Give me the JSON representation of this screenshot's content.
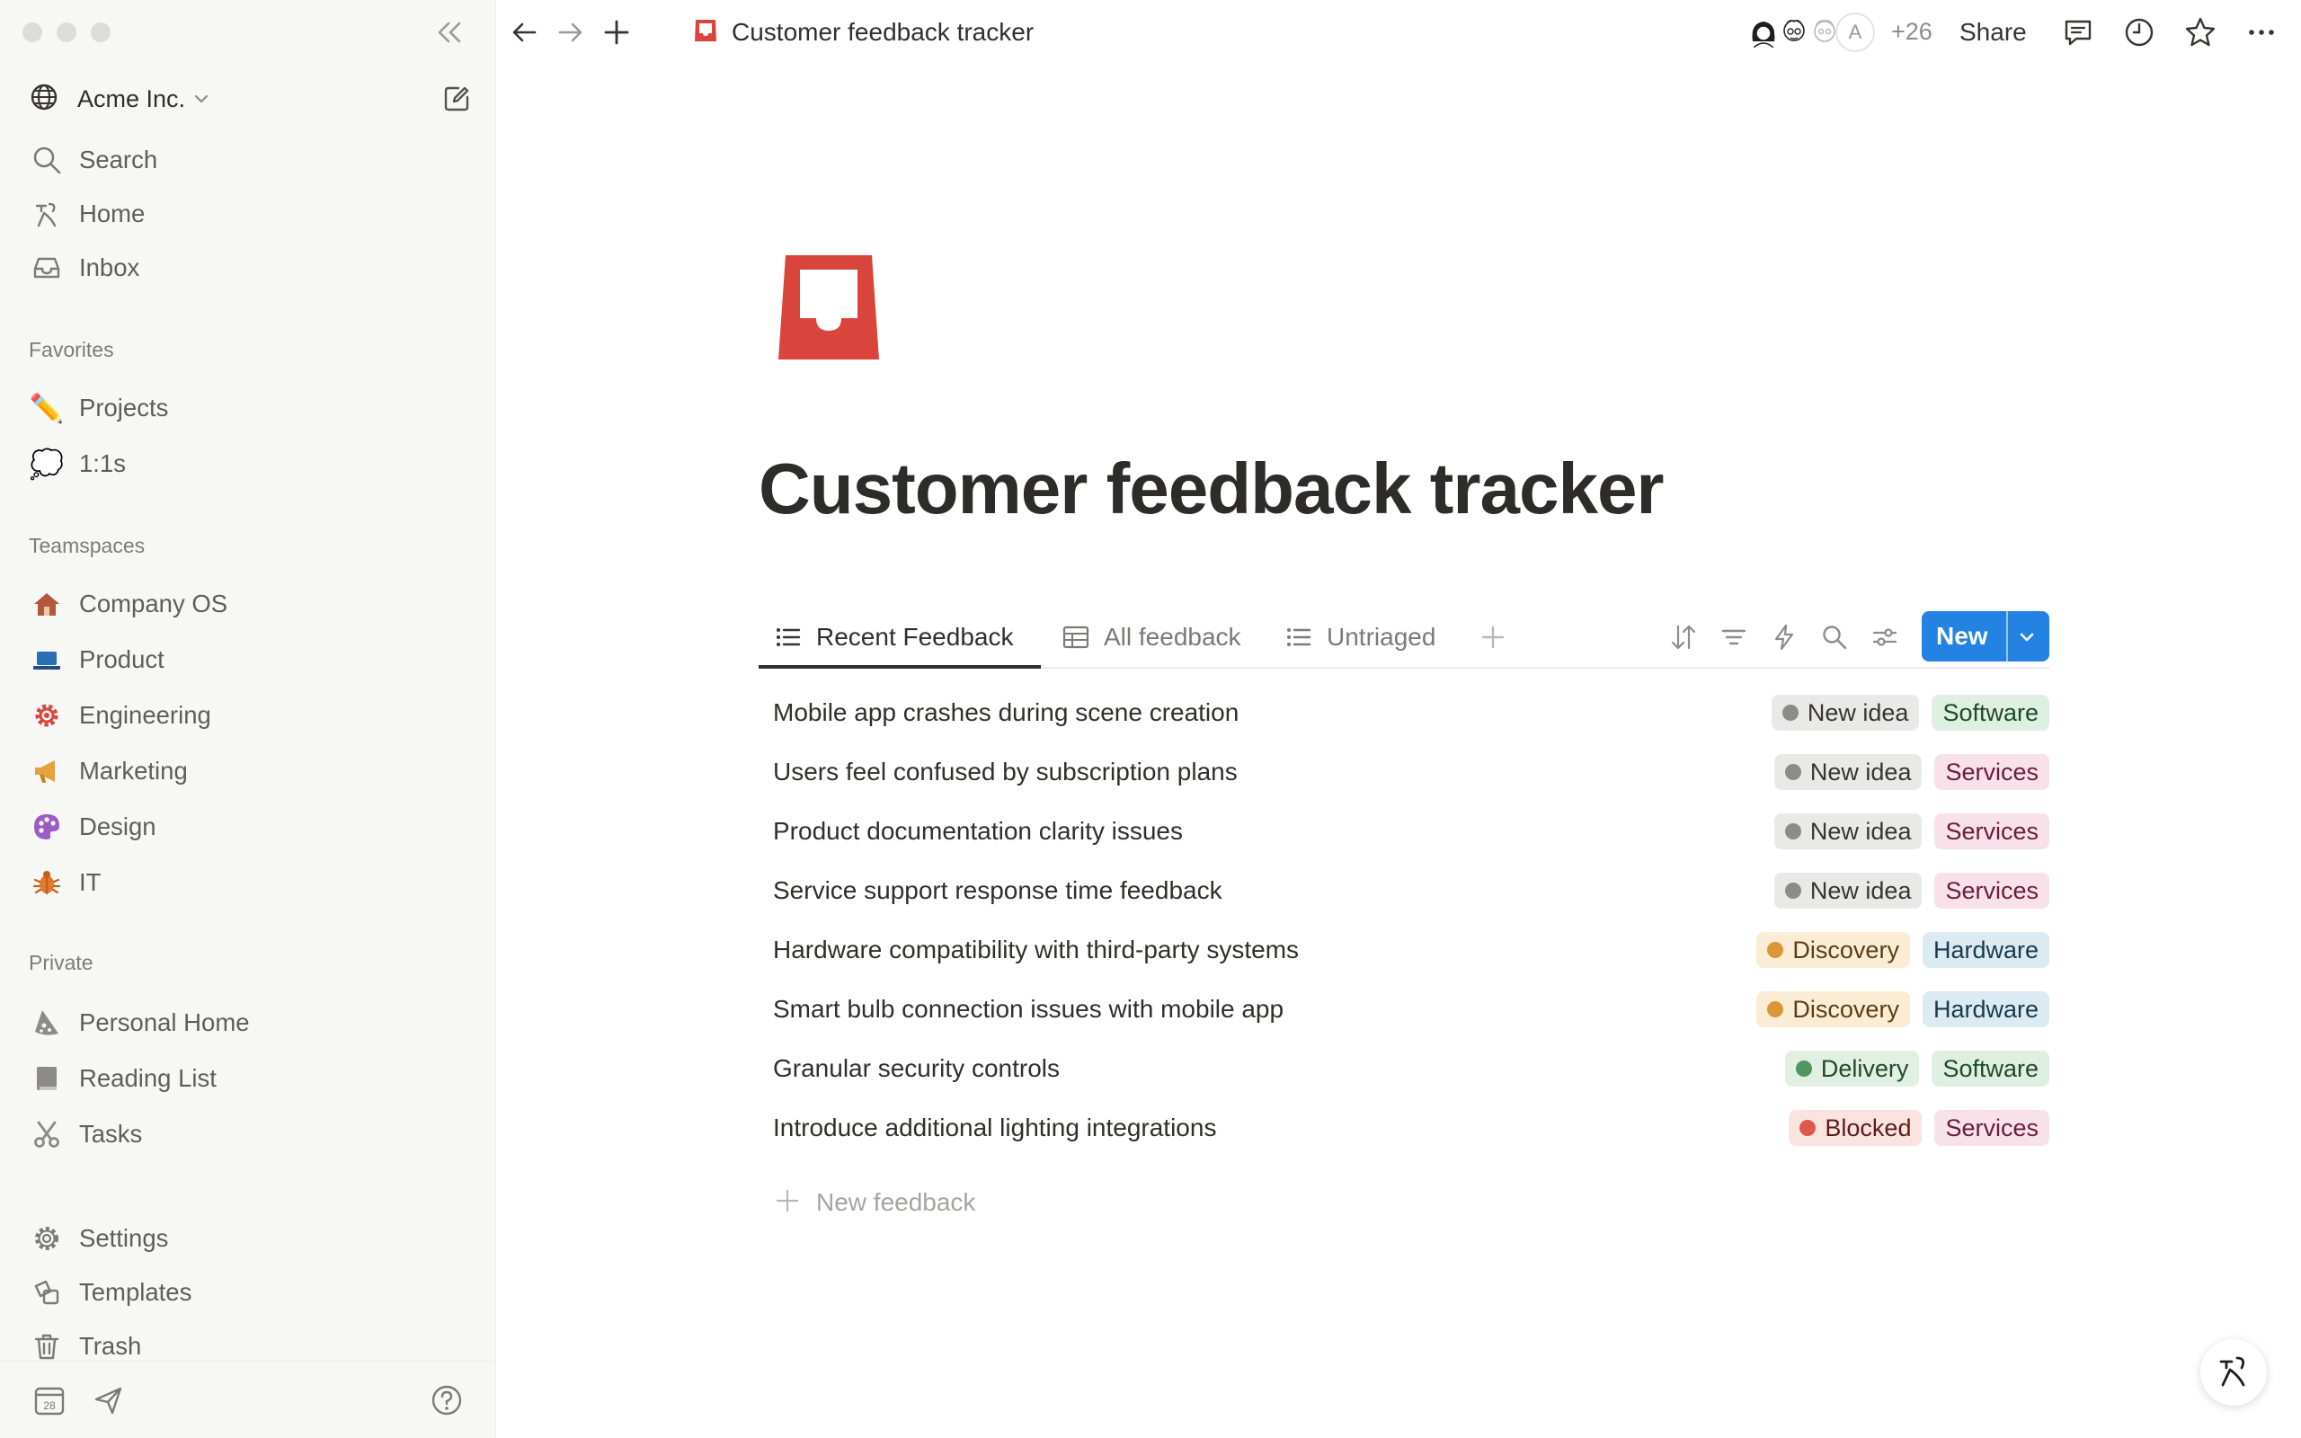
{
  "sidebar": {
    "workspace_name": "Acme Inc.",
    "nav": [
      {
        "label": "Search",
        "icon": "search-icon"
      },
      {
        "label": "Home",
        "icon": "home-icon"
      },
      {
        "label": "Inbox",
        "icon": "inbox-icon"
      }
    ],
    "favorites_label": "Favorites",
    "favorites": [
      {
        "label": "Projects",
        "icon": "pencil-icon"
      },
      {
        "label": "1:1s",
        "icon": "speech-bubble-icon"
      }
    ],
    "teamspaces_label": "Teamspaces",
    "teamspaces": [
      {
        "label": "Company OS",
        "icon": "house-icon"
      },
      {
        "label": "Product",
        "icon": "laptop-icon"
      },
      {
        "label": "Engineering",
        "icon": "gear-icon"
      },
      {
        "label": "Marketing",
        "icon": "megaphone-icon"
      },
      {
        "label": "Design",
        "icon": "palette-icon"
      },
      {
        "label": "IT",
        "icon": "bug-icon"
      }
    ],
    "private_label": "Private",
    "private": [
      {
        "label": "Personal Home",
        "icon": "pizza-icon"
      },
      {
        "label": "Reading List",
        "icon": "book-icon"
      },
      {
        "label": "Tasks",
        "icon": "scissors-icon"
      }
    ],
    "footer_nav": [
      {
        "label": "Settings",
        "icon": "settings-icon"
      },
      {
        "label": "Templates",
        "icon": "templates-icon"
      },
      {
        "label": "Trash",
        "icon": "trash-icon"
      }
    ],
    "calendar_day": "28"
  },
  "topbar": {
    "page_title": "Customer feedback tracker",
    "avatar_letter": "A",
    "extra_collaborators": "+26",
    "share_label": "Share"
  },
  "page": {
    "title": "Customer feedback tracker",
    "tabs": [
      {
        "label": "Recent Feedback",
        "active": true
      },
      {
        "label": "All feedback",
        "active": false
      },
      {
        "label": "Untriaged",
        "active": false
      }
    ],
    "new_button_label": "New",
    "rows": [
      {
        "title": "Mobile app crashes during scene creation",
        "status": "New idea",
        "category": "Software"
      },
      {
        "title": "Users feel confused by subscription plans",
        "status": "New idea",
        "category": "Services"
      },
      {
        "title": "Product documentation clarity issues",
        "status": "New idea",
        "category": "Services"
      },
      {
        "title": "Service support response time feedback",
        "status": "New idea",
        "category": "Services"
      },
      {
        "title": "Hardware compatibility with third-party systems",
        "status": "Discovery",
        "category": "Hardware"
      },
      {
        "title": "Smart bulb connection issues with mobile app",
        "status": "Discovery",
        "category": "Hardware"
      },
      {
        "title": "Granular security controls",
        "status": "Delivery",
        "category": "Software"
      },
      {
        "title": "Introduce additional lighting integrations",
        "status": "Blocked",
        "category": "Services"
      }
    ],
    "new_row_label": "New feedback"
  },
  "colors": {
    "accent_blue": "#2483e2",
    "page_icon_red": "#d9453d",
    "status": {
      "New idea": {
        "bg": "#e9e9e7",
        "dot": "#8c8b88",
        "text": "#37352f"
      },
      "Discovery": {
        "bg": "#fbecd6",
        "dot": "#d9973a",
        "text": "#5a3e17"
      },
      "Delivery": {
        "bg": "#e2efe3",
        "dot": "#4f9562",
        "text": "#1f4a2a"
      },
      "Blocked": {
        "bg": "#fbe3e0",
        "dot": "#e0574d",
        "text": "#5d1c17"
      }
    },
    "category": {
      "Software": {
        "bg": "#dff0e2",
        "text": "#1f4a2a"
      },
      "Services": {
        "bg": "#f9e1ea",
        "text": "#6a1d3c"
      },
      "Hardware": {
        "bg": "#dcebf2",
        "text": "#183a4d"
      }
    }
  }
}
